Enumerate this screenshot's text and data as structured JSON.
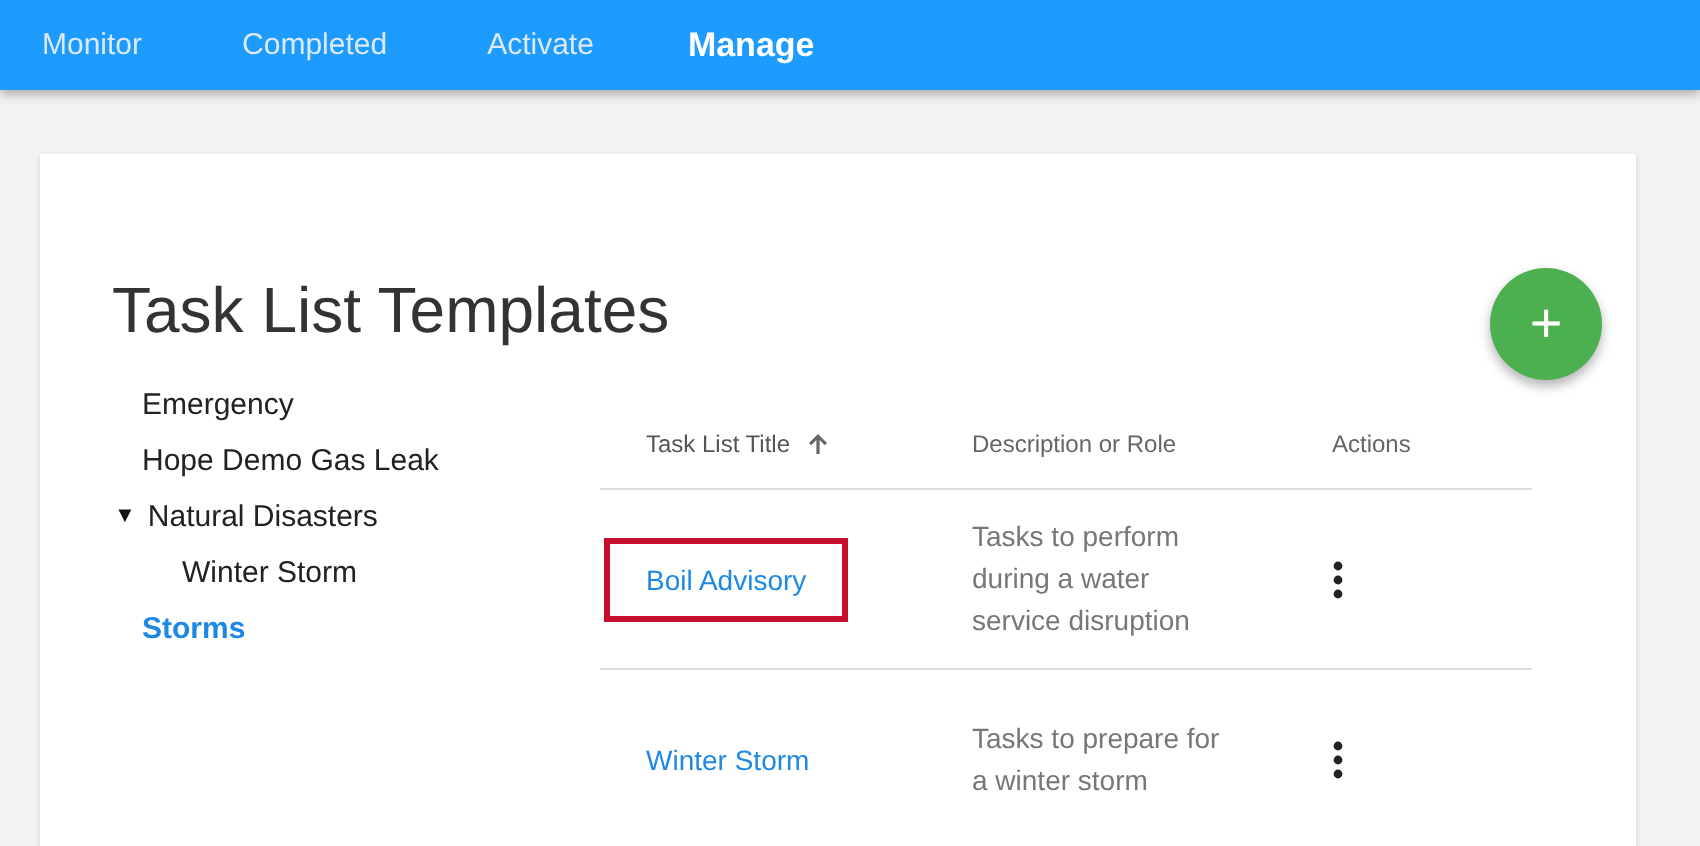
{
  "nav": [
    {
      "label": "Monitor",
      "selected": false
    },
    {
      "label": "Completed",
      "selected": false
    },
    {
      "label": "Activate",
      "selected": false
    },
    {
      "label": "Manage",
      "selected": true
    }
  ],
  "page": {
    "title": "Task List Templates",
    "add_button": "+"
  },
  "tree": [
    {
      "label": "Emergency",
      "selected": false
    },
    {
      "label": "Hope Demo Gas Leak",
      "selected": false
    },
    {
      "label": "Natural Disasters",
      "selected": false,
      "expanded": true,
      "toggle": "▼",
      "children": [
        {
          "label": "Winter Storm",
          "selected": false
        }
      ]
    },
    {
      "label": "Storms",
      "selected": true
    }
  ],
  "table": {
    "columns": [
      {
        "label": "Task List Title",
        "sorted": true
      },
      {
        "label": "Description or Role",
        "sorted": false
      },
      {
        "label": "Actions",
        "sorted": false
      }
    ],
    "rows": [
      {
        "title": "Boil Advisory",
        "description": "Tasks to perform during a water service disruption",
        "highlighted": true
      },
      {
        "title": "Winter Storm",
        "description": "Tasks to prepare for a winter storm",
        "highlighted": false
      }
    ]
  }
}
